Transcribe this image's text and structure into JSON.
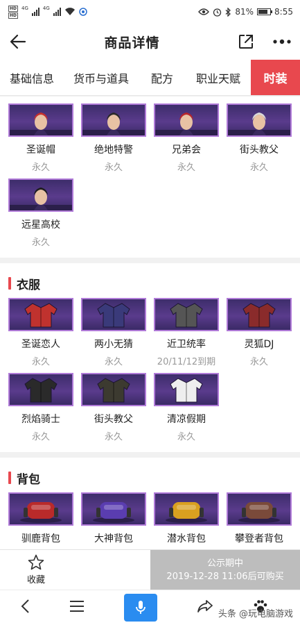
{
  "status_bar": {
    "sim1": "HD",
    "sim1_net": "4G",
    "sim2": "HD",
    "sim2_net": "4G",
    "battery": "81%",
    "battery_level": 0.81,
    "time": "8:55"
  },
  "header": {
    "title": "商品详情"
  },
  "tabs": [
    {
      "label": "基础信息",
      "active": false
    },
    {
      "label": "货币与道具",
      "active": false
    },
    {
      "label": "配方",
      "active": false
    },
    {
      "label": "职业天赋",
      "active": false
    },
    {
      "label": "时装",
      "active": true
    }
  ],
  "sections": {
    "hats": {
      "items": [
        {
          "name": "圣诞帽",
          "duration": "永久",
          "icon": "santa-hat-head-icon",
          "color": "#c9302c"
        },
        {
          "name": "绝地特警",
          "duration": "永久",
          "icon": "police-cap-head-icon",
          "color": "#2b2b2b"
        },
        {
          "name": "兄弟会",
          "duration": "永久",
          "icon": "red-mask-head-icon",
          "color": "#b8262b"
        },
        {
          "name": "街头教父",
          "duration": "永久",
          "icon": "sunglasses-head-icon",
          "color": "#d9d9d9"
        },
        {
          "name": "远星高校",
          "duration": "永久",
          "icon": "long-hair-head-icon",
          "color": "#1e1e1e"
        }
      ]
    },
    "clothes": {
      "title": "衣服",
      "items": [
        {
          "name": "圣诞恋人",
          "duration": "永久",
          "icon": "red-jacket-icon",
          "color": "#c0322e"
        },
        {
          "name": "两小无猜",
          "duration": "永久",
          "icon": "purple-jacket-icon",
          "color": "#3a3a7a"
        },
        {
          "name": "近卫统率",
          "duration": "20/11/12到期",
          "icon": "armor-vest-icon",
          "color": "#555555"
        },
        {
          "name": "灵狐DJ",
          "duration": "永久",
          "icon": "fox-jacket-icon",
          "color": "#8a2b2b"
        },
        {
          "name": "烈焰骑士",
          "duration": "永久",
          "icon": "biker-jacket-icon",
          "color": "#2a2a2a"
        },
        {
          "name": "街头教父",
          "duration": "永久",
          "icon": "suit-jacket-icon",
          "color": "#3c3a30"
        },
        {
          "name": "清凉假期",
          "duration": "永久",
          "icon": "white-dress-icon",
          "color": "#eeeeee"
        }
      ]
    },
    "backpacks": {
      "title": "背包",
      "items": [
        {
          "name": "驯鹿背包",
          "duration": "永久",
          "icon": "reindeer-backpack-icon",
          "color": "#b92a2a"
        },
        {
          "name": "大神背包",
          "duration": "永久",
          "icon": "purple-backpack-icon",
          "color": "#5a3db0"
        },
        {
          "name": "潜水背包",
          "duration": "永久",
          "icon": "diving-tank-backpack-icon",
          "color": "#d9a020"
        },
        {
          "name": "攀登者背包",
          "duration": "永久",
          "icon": "climber-backpack-icon",
          "color": "#7a4a3a"
        }
      ]
    }
  },
  "action_bar": {
    "favorite_label": "收藏",
    "buy_line1": "公示期中",
    "buy_line2": "2019-12-28 11:06后可购买"
  },
  "watermark": "头条 @玩电脑游戏",
  "colors": {
    "accent": "#e8484e",
    "thumb_border": "#b07ad8",
    "mic": "#2a8cf0",
    "disabled": "#bdbdbd"
  }
}
